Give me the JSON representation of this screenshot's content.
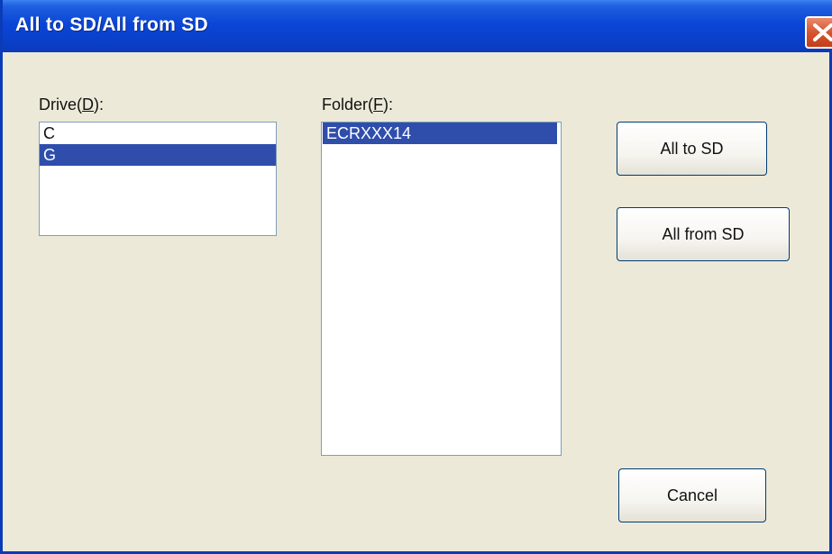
{
  "window": {
    "title": "All to SD/All from SD",
    "close_icon": "close-icon",
    "colors": {
      "titlebar": "#0a46d6",
      "background": "#ece9d8",
      "selection": "#2f4eac",
      "close": "#d8542e"
    }
  },
  "drive": {
    "label_text": "Drive(",
    "label_mnemonic": "D",
    "label_suffix": "):",
    "items": [
      "C",
      "G"
    ],
    "selected": "G"
  },
  "folder": {
    "label_text": "Folder(",
    "label_mnemonic": "F",
    "label_suffix": "):",
    "items": [
      "ECRXXX14"
    ],
    "selected": "ECRXXX14"
  },
  "buttons": {
    "all_to_sd": "All to SD",
    "all_from_sd": "All from SD",
    "cancel": "Cancel"
  }
}
